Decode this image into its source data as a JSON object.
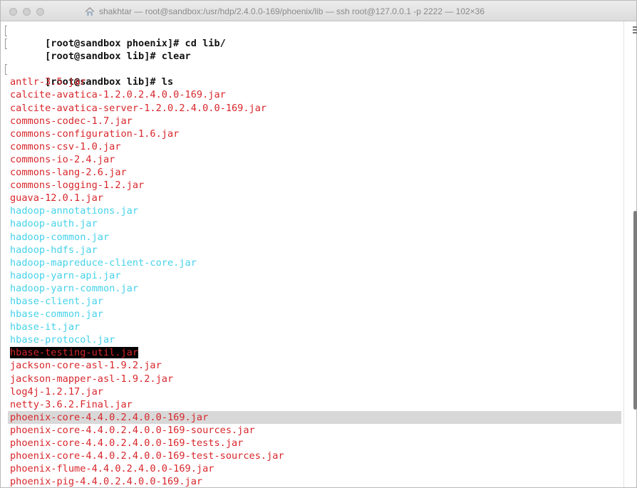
{
  "window": {
    "title": "shakhtar — root@sandbox:/usr/hdp/2.4.0.0-169/phoenix/lib — ssh root@127.0.0.1 -p 2222 — 102×36",
    "title_icon": "home-folder-icon"
  },
  "terminal": {
    "commands": [
      {
        "prompt": "[root@sandbox phoenix]# ",
        "command": "cd lib/"
      },
      {
        "prompt": "[root@sandbox lib]# ",
        "command": "clear"
      },
      {
        "prompt": "[root@sandbox lib]# ",
        "command": "ls"
      }
    ],
    "files": [
      "antlr-3.5.jar",
      "calcite-avatica-1.2.0.2.4.0.0-169.jar",
      "calcite-avatica-server-1.2.0.2.4.0.0-169.jar",
      "commons-codec-1.7.jar",
      "commons-configuration-1.6.jar",
      "commons-csv-1.0.jar",
      "commons-io-2.4.jar",
      "commons-lang-2.6.jar",
      "commons-logging-1.2.jar",
      "guava-12.0.1.jar",
      "hadoop-annotations.jar",
      "hadoop-auth.jar",
      "hadoop-common.jar",
      "hadoop-hdfs.jar",
      "hadoop-mapreduce-client-core.jar",
      "hadoop-yarn-api.jar",
      "hadoop-yarn-common.jar",
      "hbase-client.jar",
      "hbase-common.jar",
      "hbase-it.jar",
      "hbase-protocol.jar",
      "hbase-testing-util.jar",
      "jackson-core-asl-1.9.2.jar",
      "jackson-mapper-asl-1.9.2.jar",
      "log4j-1.2.17.jar",
      "netty-3.6.2.Final.jar",
      "phoenix-core-4.4.0.2.4.0.0-169.jar",
      "phoenix-core-4.4.0.2.4.0.0-169-sources.jar",
      "phoenix-core-4.4.0.2.4.0.0-169-tests.jar",
      "phoenix-core-4.4.0.2.4.0.0-169-test-sources.jar",
      "phoenix-flume-4.4.0.2.4.0.0-169.jar",
      "phoenix-pig-4.4.0.2.4.0.0-169.jar"
    ]
  },
  "colors": {
    "file_red": "#d8262b",
    "file_cyan": "#44d2ea",
    "highlight_bg": "#000000",
    "selection_bg": "#d8d8d8",
    "prompt": "#111111"
  }
}
